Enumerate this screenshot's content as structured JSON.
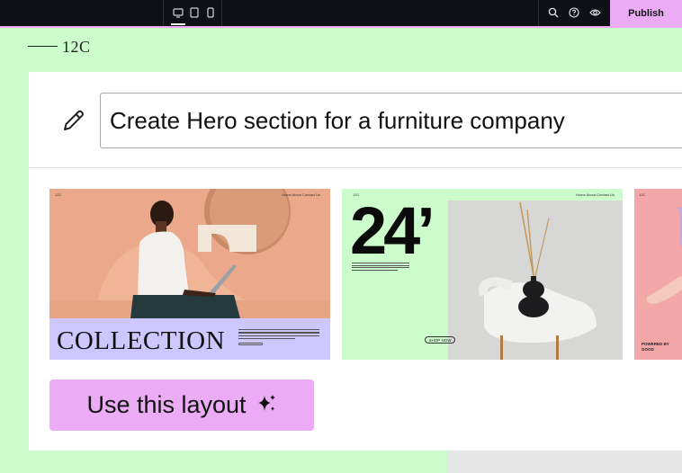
{
  "toolbar": {
    "devices": [
      "desktop-icon",
      "tablet-icon",
      "mobile-icon"
    ],
    "tools": [
      "search-icon",
      "help-icon",
      "eye-icon"
    ],
    "publish_label": "Publish"
  },
  "logo": {
    "text": "12C"
  },
  "prompt": {
    "value": "Create Hero section for a furniture company"
  },
  "thumbnails": [
    {
      "nav_logo": "12C",
      "nav_links": "Home   About   Contact Us",
      "headline": "COLLECTION"
    },
    {
      "nav_logo": "12C",
      "nav_links": "Home   About   Contact Us",
      "headline": "24’",
      "button": "SHOP NOW"
    },
    {
      "nav_logo": "12C",
      "caption": "POWERED BY\nGOOD"
    }
  ],
  "cta": {
    "label": "Use this layout"
  },
  "colors": {
    "toolbar_bg": "#0e1116",
    "accent_pink": "#ebacf5",
    "mint_bg": "#cdfccc",
    "lavender": "#cdc6ff"
  }
}
